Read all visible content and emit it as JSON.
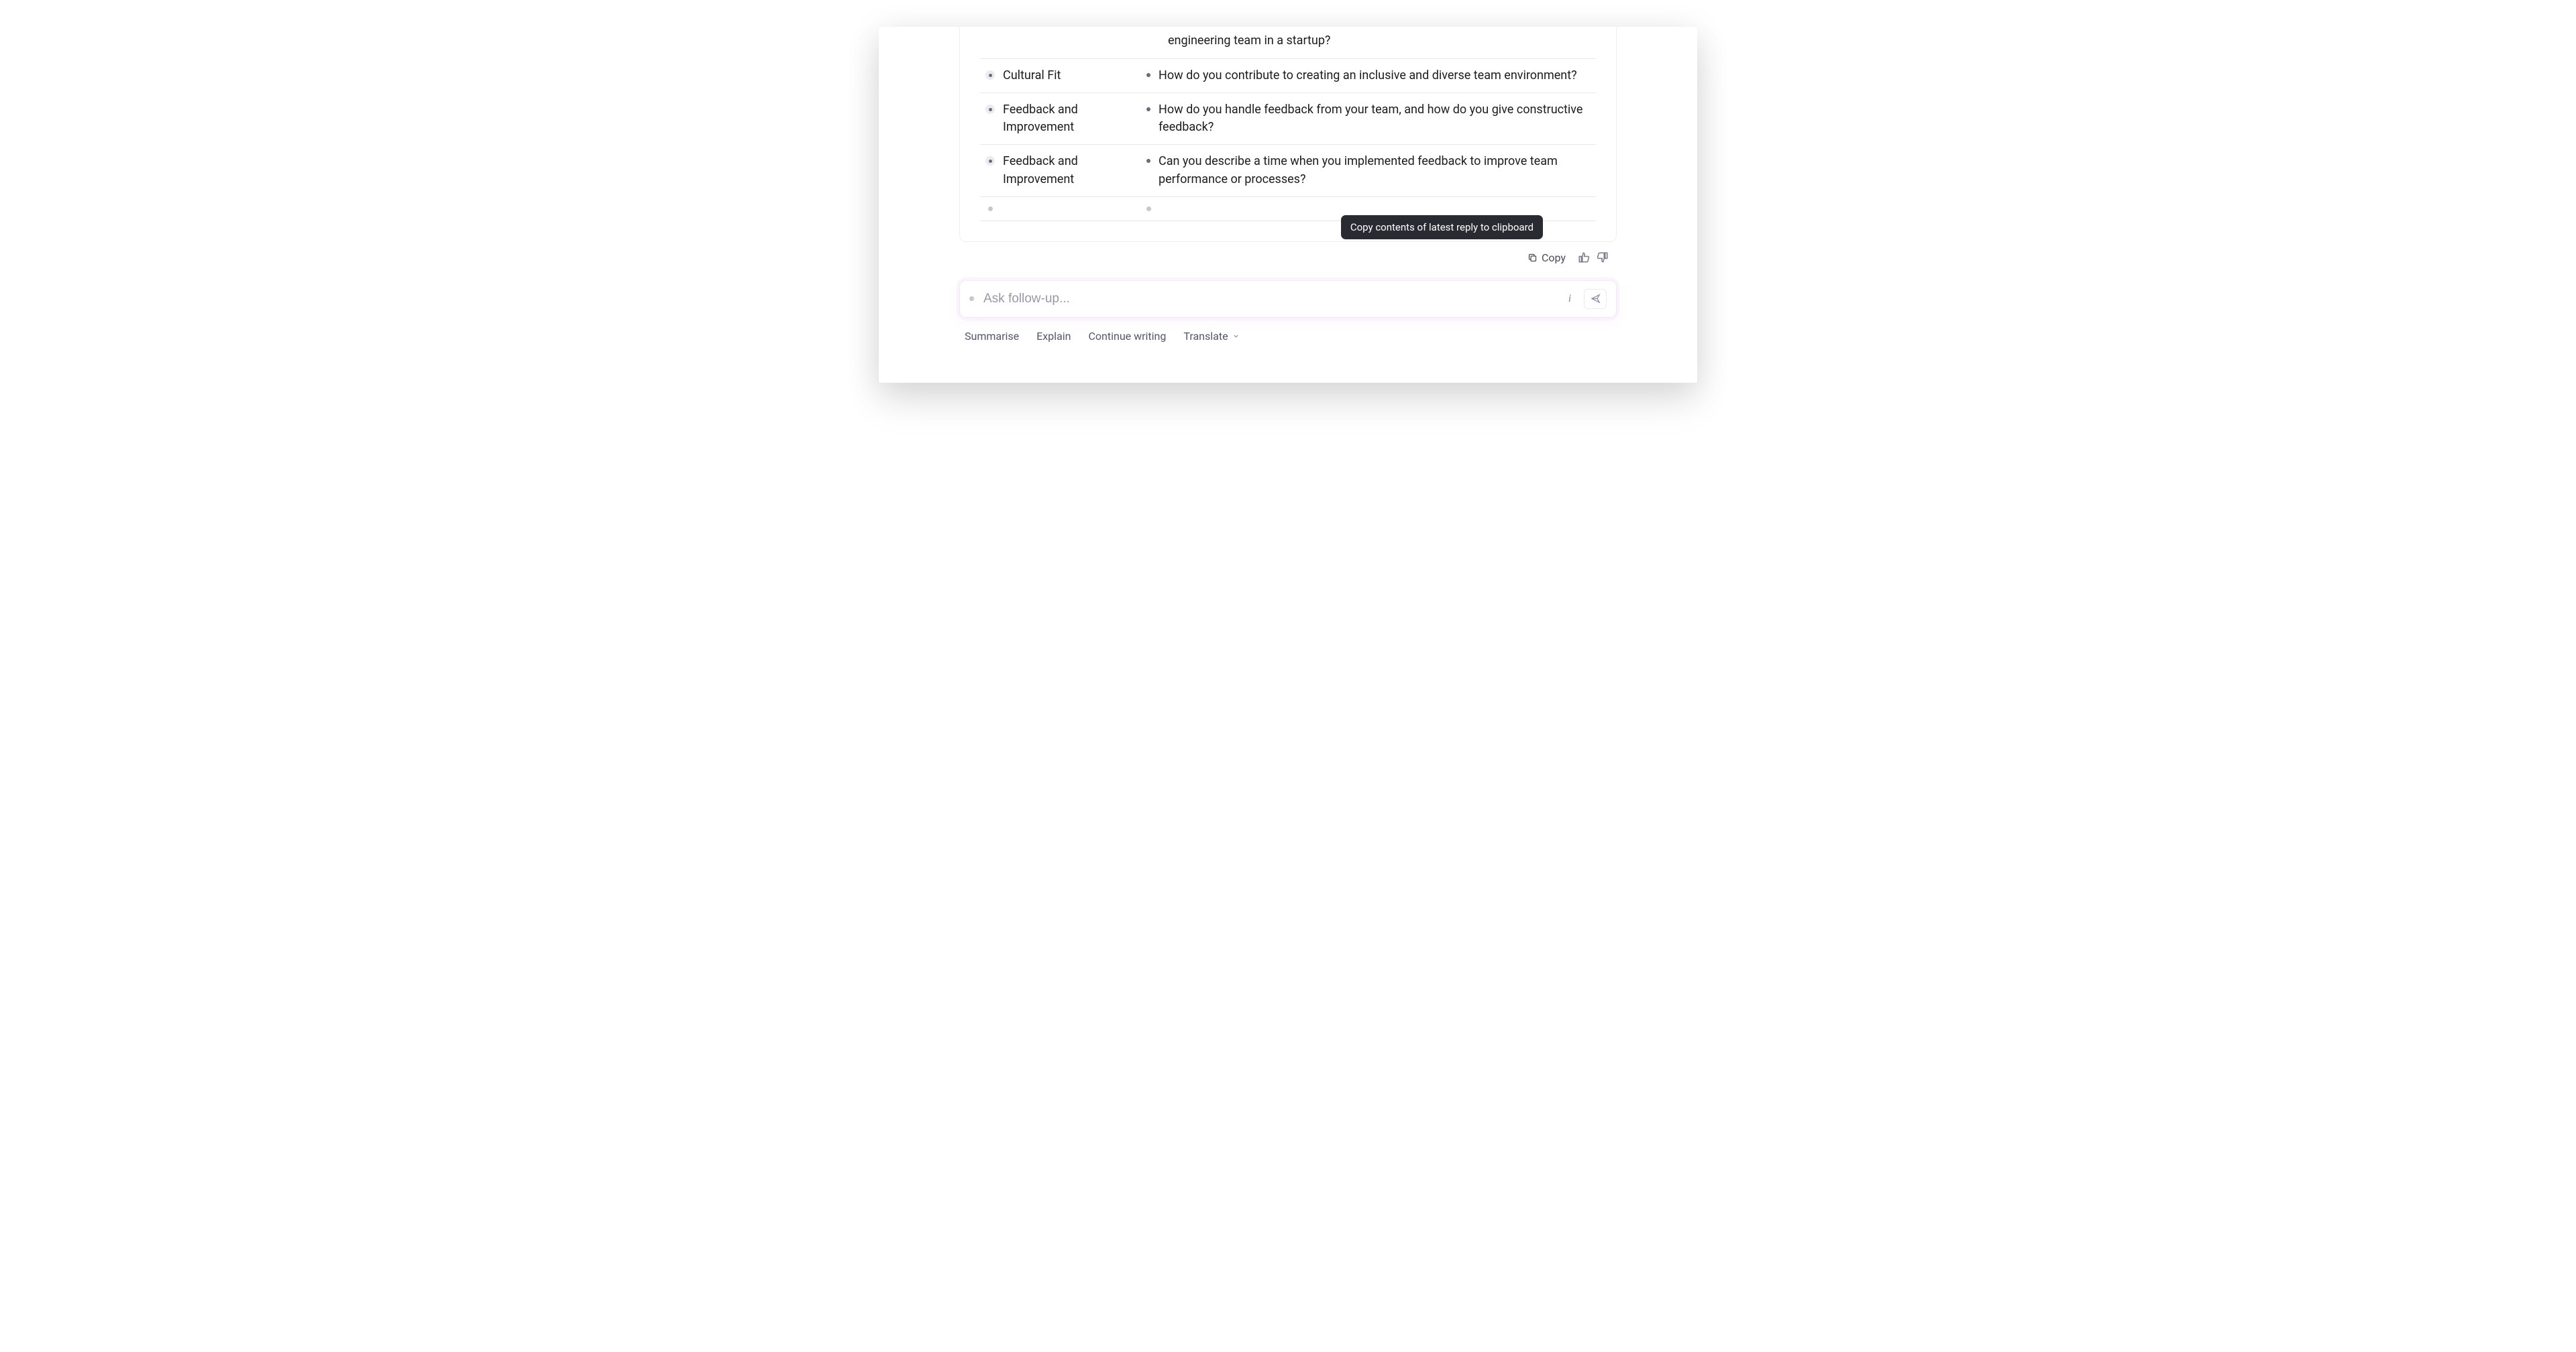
{
  "partial_row_tail": "engineering team in a startup?",
  "table_rows": [
    {
      "category": "Cultural Fit",
      "question": "How do you contribute to creating an inclusive and diverse team environment?"
    },
    {
      "category": "Feedback and Improvement",
      "question": "How do you handle feedback from your team, and how do you give constructive feedback?"
    },
    {
      "category": "Feedback and Improvement",
      "question": "Can you describe a time when you implemented feedback to improve team performance or processes?"
    }
  ],
  "tooltip": "Copy contents of latest reply to clipboard",
  "actions": {
    "copy": "Copy"
  },
  "input": {
    "placeholder": "Ask follow-up..."
  },
  "suggestions": {
    "summarise": "Summarise",
    "explain": "Explain",
    "continue": "Continue writing",
    "translate": "Translate"
  }
}
